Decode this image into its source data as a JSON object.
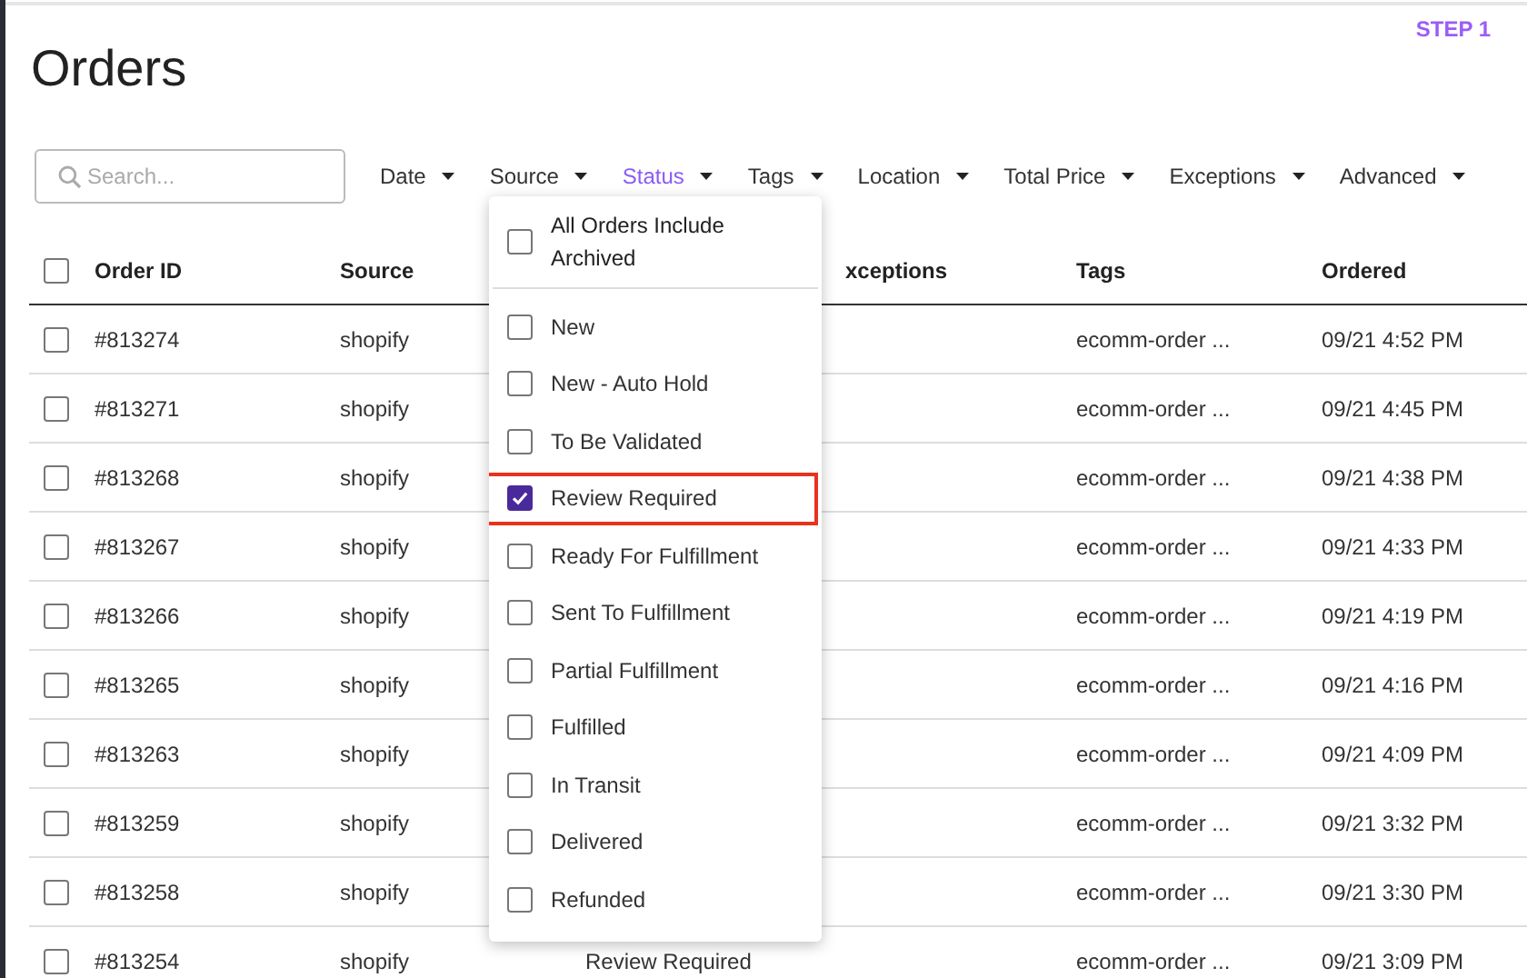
{
  "step_label": "STEP 1",
  "title": "Orders",
  "search": {
    "placeholder": "Search..."
  },
  "filters": [
    {
      "label": "Date",
      "active": false
    },
    {
      "label": "Source",
      "active": false
    },
    {
      "label": "Status",
      "active": true
    },
    {
      "label": "Tags",
      "active": false
    },
    {
      "label": "Location",
      "active": false
    },
    {
      "label": "Total Price",
      "active": false
    },
    {
      "label": "Exceptions",
      "active": false
    },
    {
      "label": "Advanced",
      "active": false
    }
  ],
  "table": {
    "select_all_checked": false,
    "columns": [
      "Order ID",
      "Source",
      "",
      "xceptions",
      "Tags",
      "Ordered"
    ],
    "rows": [
      {
        "checked": false,
        "order_id": "#813274",
        "source": "shopify",
        "tags": "ecomm-order ...",
        "ordered": "09/21 4:52 PM"
      },
      {
        "checked": false,
        "order_id": "#813271",
        "source": "shopify",
        "tags": "ecomm-order ...",
        "ordered": "09/21 4:45 PM"
      },
      {
        "checked": false,
        "order_id": "#813268",
        "source": "shopify",
        "tags": "ecomm-order ...",
        "ordered": "09/21 4:38 PM"
      },
      {
        "checked": false,
        "order_id": "#813267",
        "source": "shopify",
        "tags": "ecomm-order ...",
        "ordered": "09/21 4:33 PM"
      },
      {
        "checked": false,
        "order_id": "#813266",
        "source": "shopify",
        "tags": "ecomm-order ...",
        "ordered": "09/21 4:19 PM"
      },
      {
        "checked": false,
        "order_id": "#813265",
        "source": "shopify",
        "tags": "ecomm-order ...",
        "ordered": "09/21 4:16 PM"
      },
      {
        "checked": false,
        "order_id": "#813263",
        "source": "shopify",
        "tags": "ecomm-order ...",
        "ordered": "09/21 4:09 PM"
      },
      {
        "checked": false,
        "order_id": "#813259",
        "source": "shopify",
        "tags": "ecomm-order ...",
        "ordered": "09/21 3:32 PM"
      },
      {
        "checked": false,
        "order_id": "#813258",
        "source": "shopify",
        "tags": "ecomm-order ...",
        "ordered": "09/21 3:30 PM"
      },
      {
        "checked": false,
        "order_id": "#813254",
        "source": "shopify",
        "status": "Review Required",
        "tags": "ecomm-order ...",
        "ordered": "09/21 3:09 PM"
      }
    ]
  },
  "status_menu": {
    "header": {
      "label": "All Orders Include Archived",
      "checked": false
    },
    "options": [
      {
        "label": "New",
        "checked": false,
        "highlighted": false
      },
      {
        "label": "New - Auto Hold",
        "checked": false,
        "highlighted": false
      },
      {
        "label": "To Be Validated",
        "checked": false,
        "highlighted": false
      },
      {
        "label": "Review Required",
        "checked": true,
        "highlighted": true
      },
      {
        "label": "Ready For Fulfillment",
        "checked": false,
        "highlighted": false
      },
      {
        "label": "Sent To Fulfillment",
        "checked": false,
        "highlighted": false
      },
      {
        "label": "Partial Fulfillment",
        "checked": false,
        "highlighted": false
      },
      {
        "label": "Fulfilled",
        "checked": false,
        "highlighted": false
      },
      {
        "label": "In Transit",
        "checked": false,
        "highlighted": false
      },
      {
        "label": "Delivered",
        "checked": false,
        "highlighted": false
      },
      {
        "label": "Refunded",
        "checked": false,
        "highlighted": false
      }
    ]
  }
}
